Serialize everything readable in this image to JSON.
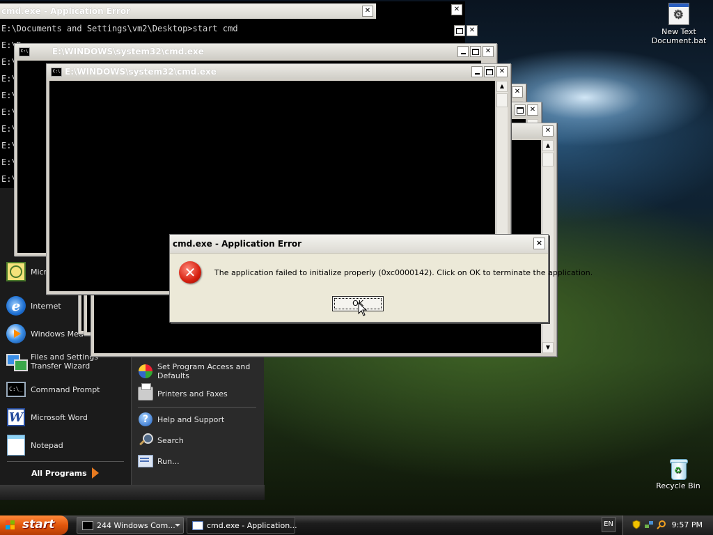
{
  "console": {
    "error_title": "cmd.exe - Application Error",
    "prompt_line": "E:\\Documents and Settings\\vm2\\Desktop>start cmd",
    "truncated_prefix": "E:\\Docume"
  },
  "windows": {
    "cmd_title": "E:\\WINDOWS\\system32\\cmd.exe",
    "cmd_icon_text": "C:\\"
  },
  "error_dialog": {
    "title": "cmd.exe - Application Error",
    "message": "The application failed to initialize properly (0xc0000142). Click on OK to terminate the application.",
    "ok_label": "OK",
    "close_label": "×"
  },
  "desktop_icons": [
    {
      "label": "New Text\nDocument.bat",
      "icon": "batch-file-icon"
    },
    {
      "label": "Recycle Bin",
      "icon": "recycle-bin-icon"
    }
  ],
  "start_menu": {
    "left_items": [
      {
        "label": "Micro",
        "icon": "outlook-icon"
      },
      {
        "label": "Internet",
        "icon": "internet-explorer-icon"
      },
      {
        "label": "Windows Med",
        "icon": "windows-media-player-icon"
      },
      {
        "label": "Files and Settings Transfer Wizard",
        "icon": "transfer-wizard-icon"
      },
      {
        "label": "Command Prompt",
        "icon": "command-prompt-icon"
      },
      {
        "label": "Microsoft Word",
        "icon": "word-icon"
      },
      {
        "label": "Notepad",
        "icon": "notepad-icon"
      }
    ],
    "all_programs": "All Programs",
    "right_items": [
      {
        "label": "Set Program Access and Defaults",
        "icon": "program-access-icon"
      },
      {
        "label": "Printers and Faxes",
        "icon": "printer-icon"
      },
      {
        "label": "Help and Support",
        "icon": "help-icon"
      },
      {
        "label": "Search",
        "icon": "search-icon"
      },
      {
        "label": "Run...",
        "icon": "run-icon"
      }
    ]
  },
  "taskbar": {
    "start_label": "start",
    "tasks": [
      {
        "label": "244 Windows Com...",
        "icon": "cmd-icon",
        "active": false
      },
      {
        "label": "cmd.exe - Application...",
        "icon": "window-icon",
        "active": true
      }
    ],
    "language": "EN",
    "clock": "9:57 PM"
  },
  "colors": {
    "desktop_sky": "#12273a",
    "desktop_grass": "#23381a",
    "start_orange": "#e2560c",
    "error_red": "#d61f0f"
  }
}
